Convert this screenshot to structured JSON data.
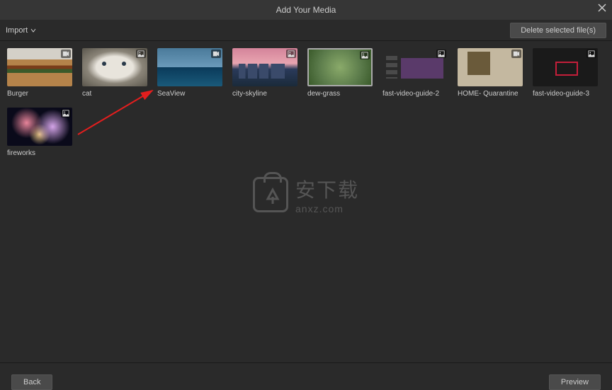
{
  "titlebar": {
    "title": "Add Your Media"
  },
  "toolbar": {
    "import_label": "Import",
    "delete_label": "Delete selected file(s)"
  },
  "media": [
    {
      "label": "Burger",
      "type": "video",
      "selected": false,
      "thumb": "th-burger"
    },
    {
      "label": "cat",
      "type": "image",
      "selected": false,
      "thumb": "th-cat"
    },
    {
      "label": "SeaView",
      "type": "video",
      "selected": false,
      "thumb": "th-sea"
    },
    {
      "label": "city-skyline",
      "type": "image",
      "selected": false,
      "thumb": "th-city"
    },
    {
      "label": "dew-grass",
      "type": "image",
      "selected": true,
      "thumb": "th-dew"
    },
    {
      "label": "fast-video-guide-2",
      "type": "image",
      "selected": false,
      "thumb": "th-guide2"
    },
    {
      "label": "HOME- Quarantine",
      "type": "video",
      "selected": false,
      "thumb": "th-home"
    },
    {
      "label": "fast-video-guide-3",
      "type": "image",
      "selected": false,
      "thumb": "th-guide3"
    },
    {
      "label": "fireworks",
      "type": "image",
      "selected": false,
      "thumb": "th-fireworks"
    }
  ],
  "footer": {
    "back_label": "Back",
    "preview_label": "Preview"
  },
  "watermark": {
    "main": "安下载",
    "sub": "anxz.com"
  }
}
